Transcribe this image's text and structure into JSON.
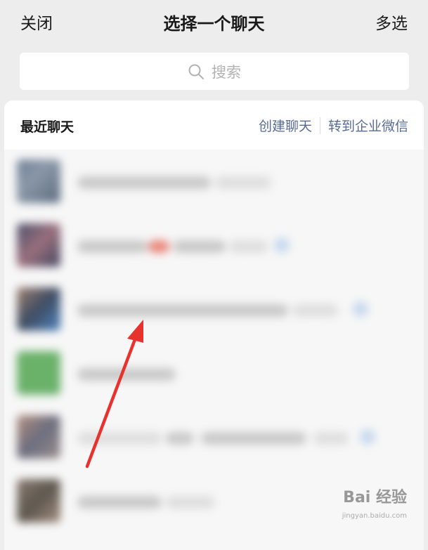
{
  "nav": {
    "close_label": "关闭",
    "title": "选择一个聊天",
    "multi_select_label": "多选"
  },
  "search": {
    "placeholder": "搜索"
  },
  "recent": {
    "section_label": "最近聊天",
    "create_chat_label": "创建聊天",
    "transfer_label": "转到企业微信"
  },
  "colors": {
    "link": "#576b95",
    "background": "#ededed",
    "arrow": "#e8322d"
  },
  "watermark": {
    "text": "Bai 经验",
    "sub": "jingyan.baidu.com"
  }
}
